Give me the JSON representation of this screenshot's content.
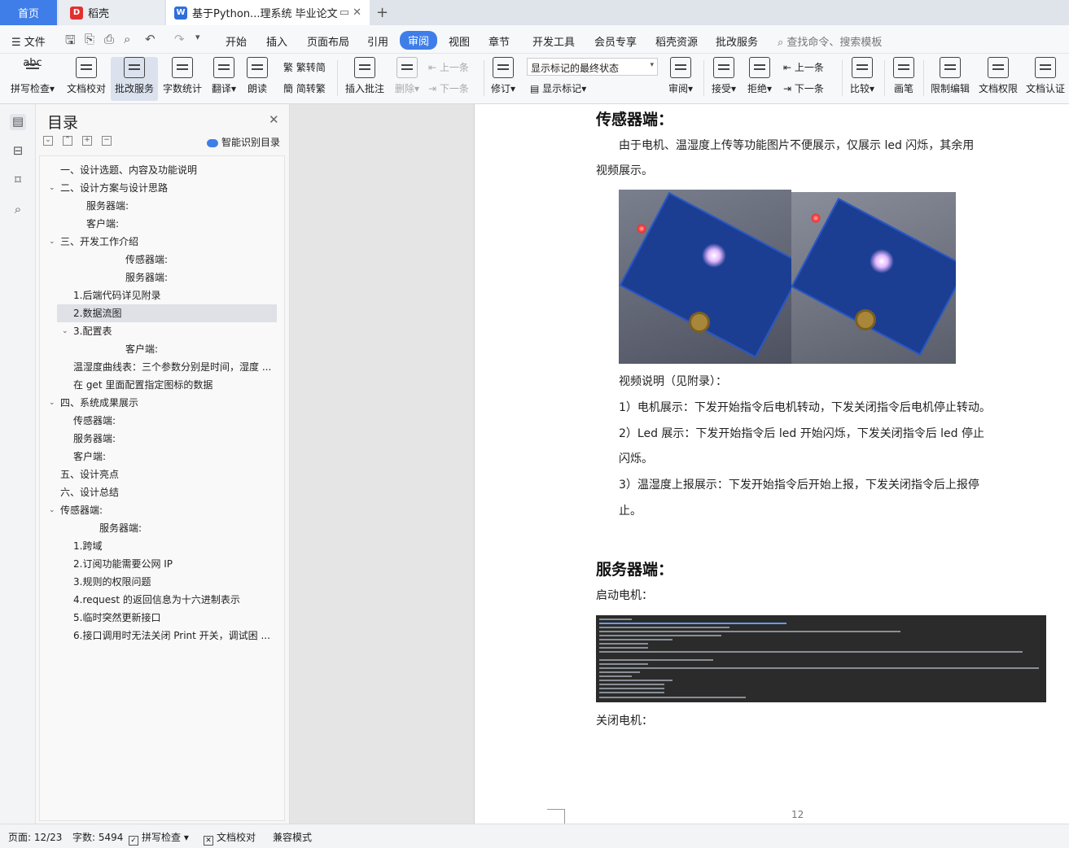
{
  "tabs": {
    "home": "首页",
    "daoke": "稻壳",
    "doc": "基于Python...理系统 毕业论文"
  },
  "menu": {
    "file": "文件",
    "items": [
      "开始",
      "插入",
      "页面布局",
      "引用",
      "审阅",
      "视图",
      "章节",
      "开发工具",
      "会员专享",
      "稻壳资源",
      "批改服务"
    ],
    "search": "查找命令、搜索模板"
  },
  "ribbon": {
    "spell": "拼写检查",
    "doccheck": "文档校对",
    "grade": "批改服务",
    "wordcount": "字数统计",
    "translate": "翻译",
    "read": "朗读",
    "to_trad": "繁转简",
    "to_simp": "简转繁",
    "insert_comment": "插入批注",
    "delete": "删除",
    "prev": "上一条",
    "next": "下一条",
    "revise": "修订",
    "markup_state": "显示标记的最终状态",
    "show_markup": "显示标记",
    "review": "审阅",
    "accept": "接受",
    "reject": "拒绝",
    "prev2": "上一条",
    "next2": "下一条",
    "compare": "比较",
    "pen": "画笔",
    "restrict": "限制编辑",
    "perm": "文档权限",
    "cert": "文档认证"
  },
  "toc": {
    "title": "目录",
    "smart": "智能识别目录",
    "items": [
      "一、设计选题、内容及功能说明",
      "二、设计方案与设计思路",
      "服务器端:",
      "客户端:",
      "三、开发工作介绍",
      "传感器端:",
      "服务器端:",
      "1.后端代码详见附录",
      "2.数据流图",
      "3.配置表",
      "客户端:",
      "温湿度曲线表：三个参数分别是时间，湿度 ...",
      "在 get 里面配置指定图标的数据",
      "四、系统成果展示",
      "传感器端:",
      "服务器端:",
      "客户端:",
      "五、设计亮点",
      "六、设计总结",
      "传感器端:",
      "服务器端:",
      "1.跨域",
      "2.订阅功能需要公网 IP",
      "3.规则的权限问题",
      "4.request 的返回信息为十六进制表示",
      "5.临时突然更新接口",
      "6.接口调用时无法关闭 Print 开关，调试困 ..."
    ]
  },
  "doc": {
    "h_sensor": "传感器端：",
    "p1_line1": "由于电机、温湿度上传等功能图片不便展示，仅展示 led 闪烁，其余用",
    "p1_line2": "视频展示。",
    "video_title": "视频说明（见附录）：",
    "v1": "1）电机展示：下发开始指令后电机转动，下发关闭指令后电机停止转动。",
    "v2_line1": "2）Led 展示：下发开始指令后 led 开始闪烁，下发关闭指令后 led 停止",
    "v2_line2": "闪烁。",
    "v3_line1": "3）温湿度上报展示：下发开始指令后开始上报，下发关闭指令后上报停",
    "v3_line2": "止。",
    "h_server": "服务器端：",
    "start_motor": "启动电机：",
    "stop_motor": "关闭电机：",
    "page_number": "12"
  },
  "status": {
    "page": "页面: 12/23",
    "words": "字数: 5494",
    "spell": "拼写检查",
    "proof": "文档校对",
    "compat": "兼容模式"
  },
  "colors": {
    "accent": "#3f7ee8",
    "terminal_bg": "#2b2b2b",
    "board_blue": "#1c3e92"
  }
}
